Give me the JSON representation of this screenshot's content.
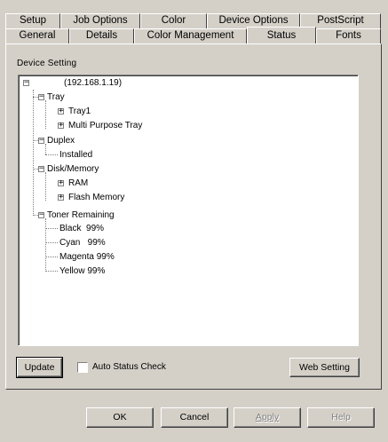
{
  "tabs_row1": [
    {
      "label": "Setup"
    },
    {
      "label": "Job Options"
    },
    {
      "label": "Color"
    },
    {
      "label": "Device Options"
    },
    {
      "label": "PostScript"
    }
  ],
  "tabs_row2": [
    {
      "label": "General"
    },
    {
      "label": "Details"
    },
    {
      "label": "Color Management"
    },
    {
      "label": "Status"
    },
    {
      "label": "Fonts"
    }
  ],
  "active_tab": "Status",
  "group_label": "Device Setting",
  "tree": {
    "root": "(192.168.1.19)",
    "tray": "Tray",
    "tray1": "Tray1",
    "multi_purpose_tray": "Multi Purpose Tray",
    "duplex": "Duplex",
    "installed": "Installed",
    "disk_memory": "Disk/Memory",
    "ram": "RAM",
    "flash_memory": "Flash Memory",
    "toner_remaining": "Toner Remaining",
    "black": "Black  99%",
    "cyan": "Cyan   99%",
    "magenta": "Magenta 99%",
    "yellow": "Yellow 99%"
  },
  "buttons": {
    "update": "Update",
    "auto_status_check": "Auto Status Check",
    "web_setting": "Web Setting",
    "ok": "OK",
    "cancel": "Cancel",
    "apply": "Apply",
    "help": "Help"
  }
}
